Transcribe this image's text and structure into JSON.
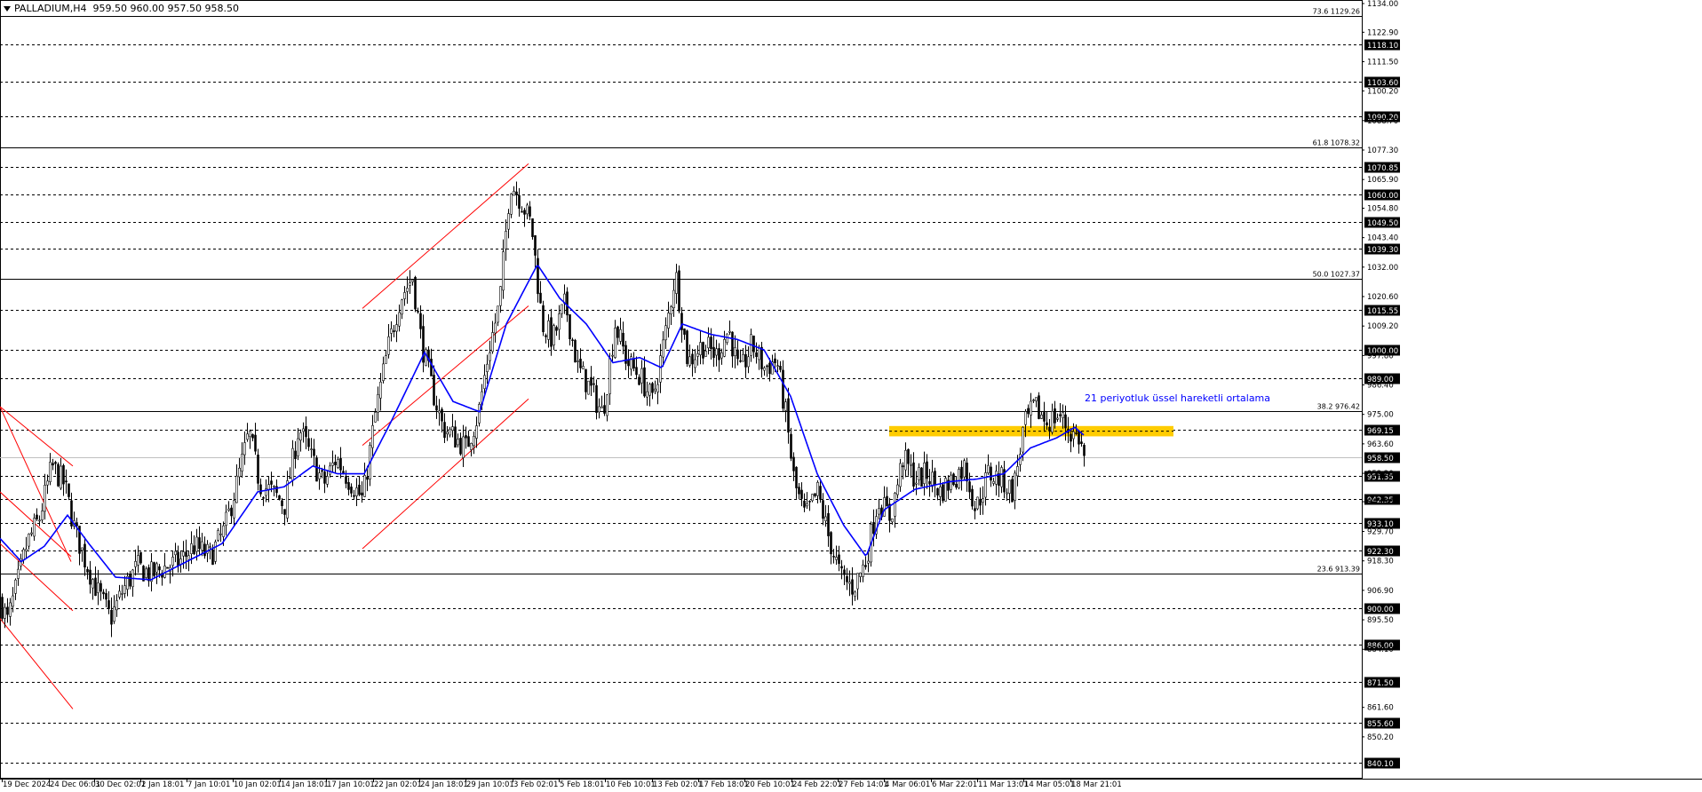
{
  "header": {
    "symbol": "PALLADIUM,H4",
    "ohlc": "959.50 960.00 957.50 958.50"
  },
  "annotation": "21 periyotluk üssel hareketli ortalama",
  "colors": {
    "background": "#ffffff",
    "candle": "#000000",
    "ema": "#0000ff",
    "channel": "#ff0000",
    "zone": "#ffcc00",
    "grid": "#000000",
    "annotation": "#0000ff"
  },
  "chart_data": {
    "type": "candlestick",
    "title": "",
    "ylim": [
      834.7,
      1134.0
    ],
    "price_axis_ticks": [
      "1134.00",
      "1122.90",
      "1111.50",
      "1100.20",
      "1088.70",
      "1077.30",
      "1065.90",
      "1054.80",
      "1043.40",
      "1032.00",
      "1020.60",
      "1009.20",
      "997.80",
      "986.40",
      "975.00",
      "963.60",
      "952.20",
      "941.20",
      "929.70",
      "918.30",
      "906.90",
      "895.50",
      "884.10",
      "861.60",
      "850.20"
    ],
    "x_axis_labels": [
      "19 Dec 2024",
      "24 Dec 06:01",
      "30 Dec 02:01",
      "2 Jan 18:01",
      "7 Jan 10:01",
      "10 Jan 02:01",
      "14 Jan 18:01",
      "17 Jan 10:01",
      "22 Jan 02:01",
      "24 Jan 18:01",
      "29 Jan 10:01",
      "3 Feb 02:01",
      "5 Feb 18:01",
      "10 Feb 10:01",
      "13 Feb 02:01",
      "17 Feb 18:01",
      "20 Feb 10:01",
      "24 Feb 22:01",
      "27 Feb 14:01",
      "4 Mar 06:01",
      "6 Mar 22:01",
      "11 Mar 13:01",
      "14 Mar 05:01",
      "18 Mar 21:01"
    ],
    "horizontal_levels": [
      {
        "value": 1118.1,
        "label": "1118.10"
      },
      {
        "value": 1103.6,
        "label": "1103.60"
      },
      {
        "value": 1090.2,
        "label": "1090.20"
      },
      {
        "value": 1070.85,
        "label": "1070.85"
      },
      {
        "value": 1060.0,
        "label": "1060.00"
      },
      {
        "value": 1049.5,
        "label": "1049.50"
      },
      {
        "value": 1039.3,
        "label": "1039.30"
      },
      {
        "value": 1015.55,
        "label": "1015.55"
      },
      {
        "value": 1000.0,
        "label": "1000.00"
      },
      {
        "value": 989.0,
        "label": "989.00"
      },
      {
        "value": 969.15,
        "label": "969.15"
      },
      {
        "value": 951.35,
        "label": "951.35"
      },
      {
        "value": 942.35,
        "label": "942.35"
      },
      {
        "value": 933.1,
        "label": "933.10"
      },
      {
        "value": 922.3,
        "label": "922.30"
      },
      {
        "value": 900.0,
        "label": "900.00"
      },
      {
        "value": 886.0,
        "label": "886.00"
      },
      {
        "value": 871.5,
        "label": "871.50"
      },
      {
        "value": 855.6,
        "label": "855.60"
      },
      {
        "value": 840.1,
        "label": "840.10"
      }
    ],
    "current_price": {
      "value": 958.5,
      "label": "958.50"
    },
    "fibonacci_levels": [
      {
        "value": 1129.26,
        "label": "73.6 1129.26"
      },
      {
        "value": 1078.32,
        "label": "61.8 1078.32"
      },
      {
        "value": 1027.37,
        "label": "50.0 1027.37"
      },
      {
        "value": 976.42,
        "label": "38.2 976.42"
      },
      {
        "value": 913.39,
        "label": "23.6 913.39"
      }
    ],
    "resistance_zone": {
      "low": 966.5,
      "high": 970.5
    },
    "ema_period": 21,
    "close_path": [
      {
        "t": 0,
        "v": 903
      },
      {
        "t": 8,
        "v": 895
      },
      {
        "t": 18,
        "v": 908
      },
      {
        "t": 30,
        "v": 925
      },
      {
        "t": 44,
        "v": 935
      },
      {
        "t": 58,
        "v": 955
      },
      {
        "t": 72,
        "v": 948
      },
      {
        "t": 84,
        "v": 930
      },
      {
        "t": 96,
        "v": 918
      },
      {
        "t": 110,
        "v": 906
      },
      {
        "t": 124,
        "v": 896
      },
      {
        "t": 138,
        "v": 907
      },
      {
        "t": 154,
        "v": 916
      },
      {
        "t": 170,
        "v": 913
      },
      {
        "t": 186,
        "v": 916
      },
      {
        "t": 202,
        "v": 918
      },
      {
        "t": 218,
        "v": 924
      },
      {
        "t": 236,
        "v": 920
      },
      {
        "t": 252,
        "v": 930
      },
      {
        "t": 266,
        "v": 948
      },
      {
        "t": 280,
        "v": 968
      },
      {
        "t": 292,
        "v": 948
      },
      {
        "t": 306,
        "v": 945
      },
      {
        "t": 320,
        "v": 940
      },
      {
        "t": 336,
        "v": 970
      },
      {
        "t": 350,
        "v": 958
      },
      {
        "t": 364,
        "v": 948
      },
      {
        "t": 378,
        "v": 958
      },
      {
        "t": 392,
        "v": 950
      },
      {
        "t": 408,
        "v": 942
      },
      {
        "t": 422,
        "v": 975
      },
      {
        "t": 436,
        "v": 1000
      },
      {
        "t": 450,
        "v": 1020
      },
      {
        "t": 464,
        "v": 1028
      },
      {
        "t": 474,
        "v": 1003
      },
      {
        "t": 486,
        "v": 985
      },
      {
        "t": 498,
        "v": 970
      },
      {
        "t": 512,
        "v": 966
      },
      {
        "t": 524,
        "v": 962
      },
      {
        "t": 538,
        "v": 975
      },
      {
        "t": 550,
        "v": 1000
      },
      {
        "t": 562,
        "v": 1018
      },
      {
        "t": 574,
        "v": 1065
      },
      {
        "t": 586,
        "v": 1058
      },
      {
        "t": 598,
        "v": 1048
      },
      {
        "t": 610,
        "v": 1010
      },
      {
        "t": 622,
        "v": 1004
      },
      {
        "t": 636,
        "v": 1018
      },
      {
        "t": 650,
        "v": 993
      },
      {
        "t": 664,
        "v": 985
      },
      {
        "t": 678,
        "v": 975
      },
      {
        "t": 692,
        "v": 1010
      },
      {
        "t": 706,
        "v": 995
      },
      {
        "t": 720,
        "v": 990
      },
      {
        "t": 734,
        "v": 980
      },
      {
        "t": 748,
        "v": 1005
      },
      {
        "t": 760,
        "v": 1030
      },
      {
        "t": 774,
        "v": 995
      },
      {
        "t": 790,
        "v": 1002
      },
      {
        "t": 806,
        "v": 998
      },
      {
        "t": 820,
        "v": 1008
      },
      {
        "t": 832,
        "v": 990
      },
      {
        "t": 846,
        "v": 1002
      },
      {
        "t": 860,
        "v": 993
      },
      {
        "t": 874,
        "v": 996
      },
      {
        "t": 884,
        "v": 975
      },
      {
        "t": 894,
        "v": 948
      },
      {
        "t": 906,
        "v": 935
      },
      {
        "t": 920,
        "v": 945
      },
      {
        "t": 932,
        "v": 928
      },
      {
        "t": 946,
        "v": 912
      },
      {
        "t": 960,
        "v": 908
      },
      {
        "t": 974,
        "v": 918
      },
      {
        "t": 988,
        "v": 942
      },
      {
        "t": 1002,
        "v": 935
      },
      {
        "t": 1016,
        "v": 958
      },
      {
        "t": 1030,
        "v": 950
      },
      {
        "t": 1044,
        "v": 952
      },
      {
        "t": 1058,
        "v": 945
      },
      {
        "t": 1072,
        "v": 950
      },
      {
        "t": 1086,
        "v": 955
      },
      {
        "t": 1098,
        "v": 938
      },
      {
        "t": 1112,
        "v": 952
      },
      {
        "t": 1126,
        "v": 950
      },
      {
        "t": 1140,
        "v": 945
      },
      {
        "t": 1152,
        "v": 970
      },
      {
        "t": 1164,
        "v": 978
      },
      {
        "t": 1178,
        "v": 972
      },
      {
        "t": 1192,
        "v": 975
      },
      {
        "t": 1204,
        "v": 968
      },
      {
        "t": 1214,
        "v": 966
      },
      {
        "t": 1220,
        "v": 958.5
      }
    ],
    "ema_path": [
      {
        "t": 0,
        "v": 927
      },
      {
        "t": 24,
        "v": 918
      },
      {
        "t": 50,
        "v": 924
      },
      {
        "t": 76,
        "v": 936
      },
      {
        "t": 100,
        "v": 925
      },
      {
        "t": 130,
        "v": 912
      },
      {
        "t": 170,
        "v": 911
      },
      {
        "t": 210,
        "v": 918
      },
      {
        "t": 250,
        "v": 925
      },
      {
        "t": 290,
        "v": 945
      },
      {
        "t": 320,
        "v": 947
      },
      {
        "t": 352,
        "v": 955
      },
      {
        "t": 380,
        "v": 952
      },
      {
        "t": 410,
        "v": 952
      },
      {
        "t": 440,
        "v": 972
      },
      {
        "t": 478,
        "v": 999
      },
      {
        "t": 510,
        "v": 980
      },
      {
        "t": 540,
        "v": 976
      },
      {
        "t": 570,
        "v": 1010
      },
      {
        "t": 605,
        "v": 1033
      },
      {
        "t": 630,
        "v": 1020
      },
      {
        "t": 660,
        "v": 1010
      },
      {
        "t": 690,
        "v": 995
      },
      {
        "t": 720,
        "v": 997
      },
      {
        "t": 745,
        "v": 993
      },
      {
        "t": 768,
        "v": 1010
      },
      {
        "t": 800,
        "v": 1006
      },
      {
        "t": 830,
        "v": 1004
      },
      {
        "t": 860,
        "v": 1000
      },
      {
        "t": 890,
        "v": 982
      },
      {
        "t": 920,
        "v": 952
      },
      {
        "t": 950,
        "v": 932
      },
      {
        "t": 975,
        "v": 920
      },
      {
        "t": 995,
        "v": 938
      },
      {
        "t": 1030,
        "v": 946
      },
      {
        "t": 1070,
        "v": 949
      },
      {
        "t": 1100,
        "v": 950
      },
      {
        "t": 1130,
        "v": 952
      },
      {
        "t": 1160,
        "v": 962
      },
      {
        "t": 1190,
        "v": 966
      },
      {
        "t": 1210,
        "v": 970
      },
      {
        "t": 1220,
        "v": 967
      }
    ]
  }
}
